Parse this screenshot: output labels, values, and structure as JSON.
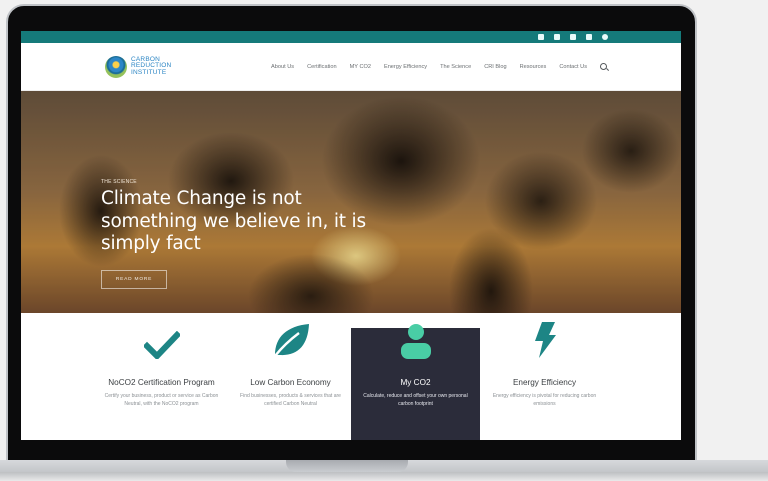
{
  "site": {
    "logo_text": [
      "CARBON",
      "REDUCTION",
      "INSTITUTE"
    ],
    "nav": [
      "About Us",
      "Certification",
      "MY CO2",
      "Energy Efficiency",
      "The Science",
      "CRI Blog",
      "Resources",
      "Contact Us"
    ],
    "social_icons": [
      "facebook-icon",
      "linkedin-icon",
      "twitter-icon",
      "mail-icon",
      "instagram-icon"
    ]
  },
  "hero": {
    "kicker": "THE SCIENCE",
    "title": "Climate Change is not something we believe in, it is simply fact",
    "button": "READ MORE"
  },
  "features": [
    {
      "title": "NoCO2 Certification Program",
      "desc": "Certify your business, product or service as Carbon Neutral, with the NoCO2 program",
      "icon": "checkmark-icon"
    },
    {
      "title": "Low Carbon Economy",
      "desc": "Find businesses, products & services that are certified Carbon Neutral",
      "icon": "leaf-icon"
    },
    {
      "title": "My CO2",
      "desc": "Calculate, reduce and offset your own personal carbon footprint",
      "icon": "person-icon",
      "active": true
    },
    {
      "title": "Energy Efficiency",
      "desc": "Energy efficiency is pivotal for reducing carbon emissions",
      "icon": "lightning-icon"
    }
  ],
  "colors": {
    "teal": "#157a7a",
    "accent": "#1d8585",
    "mint": "#49cda5",
    "dark": "#2b2c3a"
  }
}
